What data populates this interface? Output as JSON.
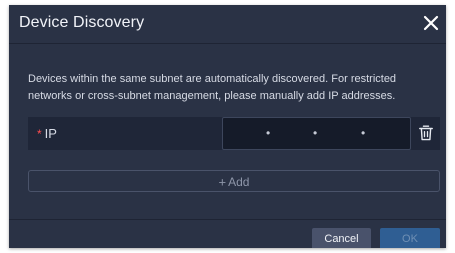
{
  "dialog": {
    "title": "Device Discovery",
    "close_icon": "close-icon",
    "description": "Devices within the same subnet are automatically discovered. For restricted networks or cross-subnet management, please manually add IP addresses.",
    "ip_field": {
      "required_marker": "*",
      "label": "IP",
      "octets": [
        "",
        "",
        "",
        ""
      ],
      "separator": "•",
      "delete_icon": "trash-icon"
    },
    "add_button": {
      "icon": "+",
      "label": "Add"
    },
    "footer": {
      "cancel_label": "Cancel",
      "ok_label": "OK"
    }
  },
  "colors": {
    "dialog_bg": "#2a3245",
    "input_bg": "#151b29",
    "required": "#ff4d4f",
    "ok_button_disabled": "#2f5e93",
    "cancel_button": "#49526b"
  }
}
